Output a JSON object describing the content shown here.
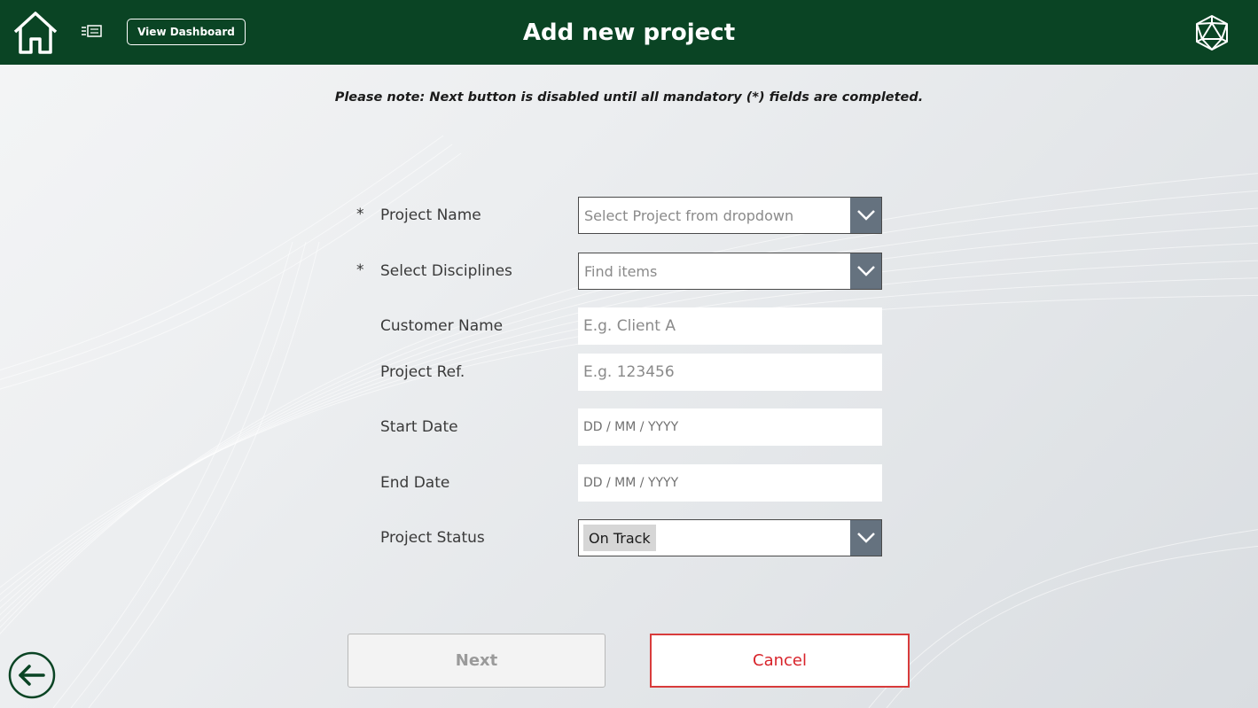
{
  "theme": {
    "header_bg": "#0a4424",
    "dropdown_button_bg": "#65727f",
    "cancel_accent": "#d83b3b"
  },
  "header": {
    "title": "Add new project",
    "dashboard_button_label": "View Dashboard",
    "home_icon": "home-icon",
    "menu_icon": "list-menu-icon",
    "logo_icon": "geodesic-logo-icon"
  },
  "form": {
    "note": "Please note: Next button is disabled until all mandatory (*) fields are completed.",
    "required_marker": "*",
    "fields": {
      "project_name": {
        "label": "Project Name",
        "required": true,
        "placeholder": "Select Project from dropdown"
      },
      "disciplines": {
        "label": "Select Disciplines",
        "required": true,
        "placeholder": "Find items"
      },
      "customer_name": {
        "label": "Customer Name",
        "placeholder": "E.g. Client A"
      },
      "project_ref": {
        "label": "Project Ref.",
        "placeholder": "E.g. 123456"
      },
      "start_date": {
        "label": "Start Date",
        "placeholder": "DD / MM / YYYY"
      },
      "end_date": {
        "label": "End Date",
        "placeholder": "DD / MM / YYYY"
      },
      "project_status": {
        "label": "Project Status",
        "value": "On Track"
      }
    }
  },
  "actions": {
    "next_label": "Next",
    "cancel_label": "Cancel",
    "back_icon": "back-arrow-icon"
  }
}
